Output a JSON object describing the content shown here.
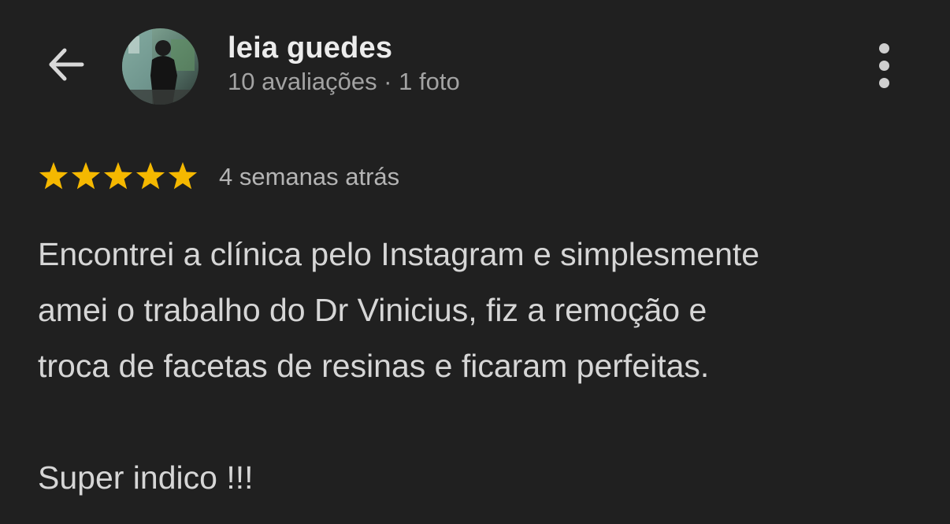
{
  "header": {
    "back_icon": "arrow-left-icon",
    "user_name": "leia guedes",
    "user_meta": "10 avaliações · 1 foto",
    "more_icon": "more-vert-icon"
  },
  "review": {
    "rating": 5,
    "rating_max": 5,
    "star_color": "#f5b800",
    "date": "4 semanas atrás",
    "lines": [
      "Encontrei a clínica pelo Instagram e simplesmente",
      "amei o trabalho do Dr Vinicius, fiz a remoção e",
      "troca de facetas de resinas e ficaram perfeitas."
    ],
    "closing": "Super indico !!!"
  },
  "colors": {
    "background": "#202020",
    "text_primary": "#ececec",
    "text_secondary": "#a3a3a3"
  }
}
